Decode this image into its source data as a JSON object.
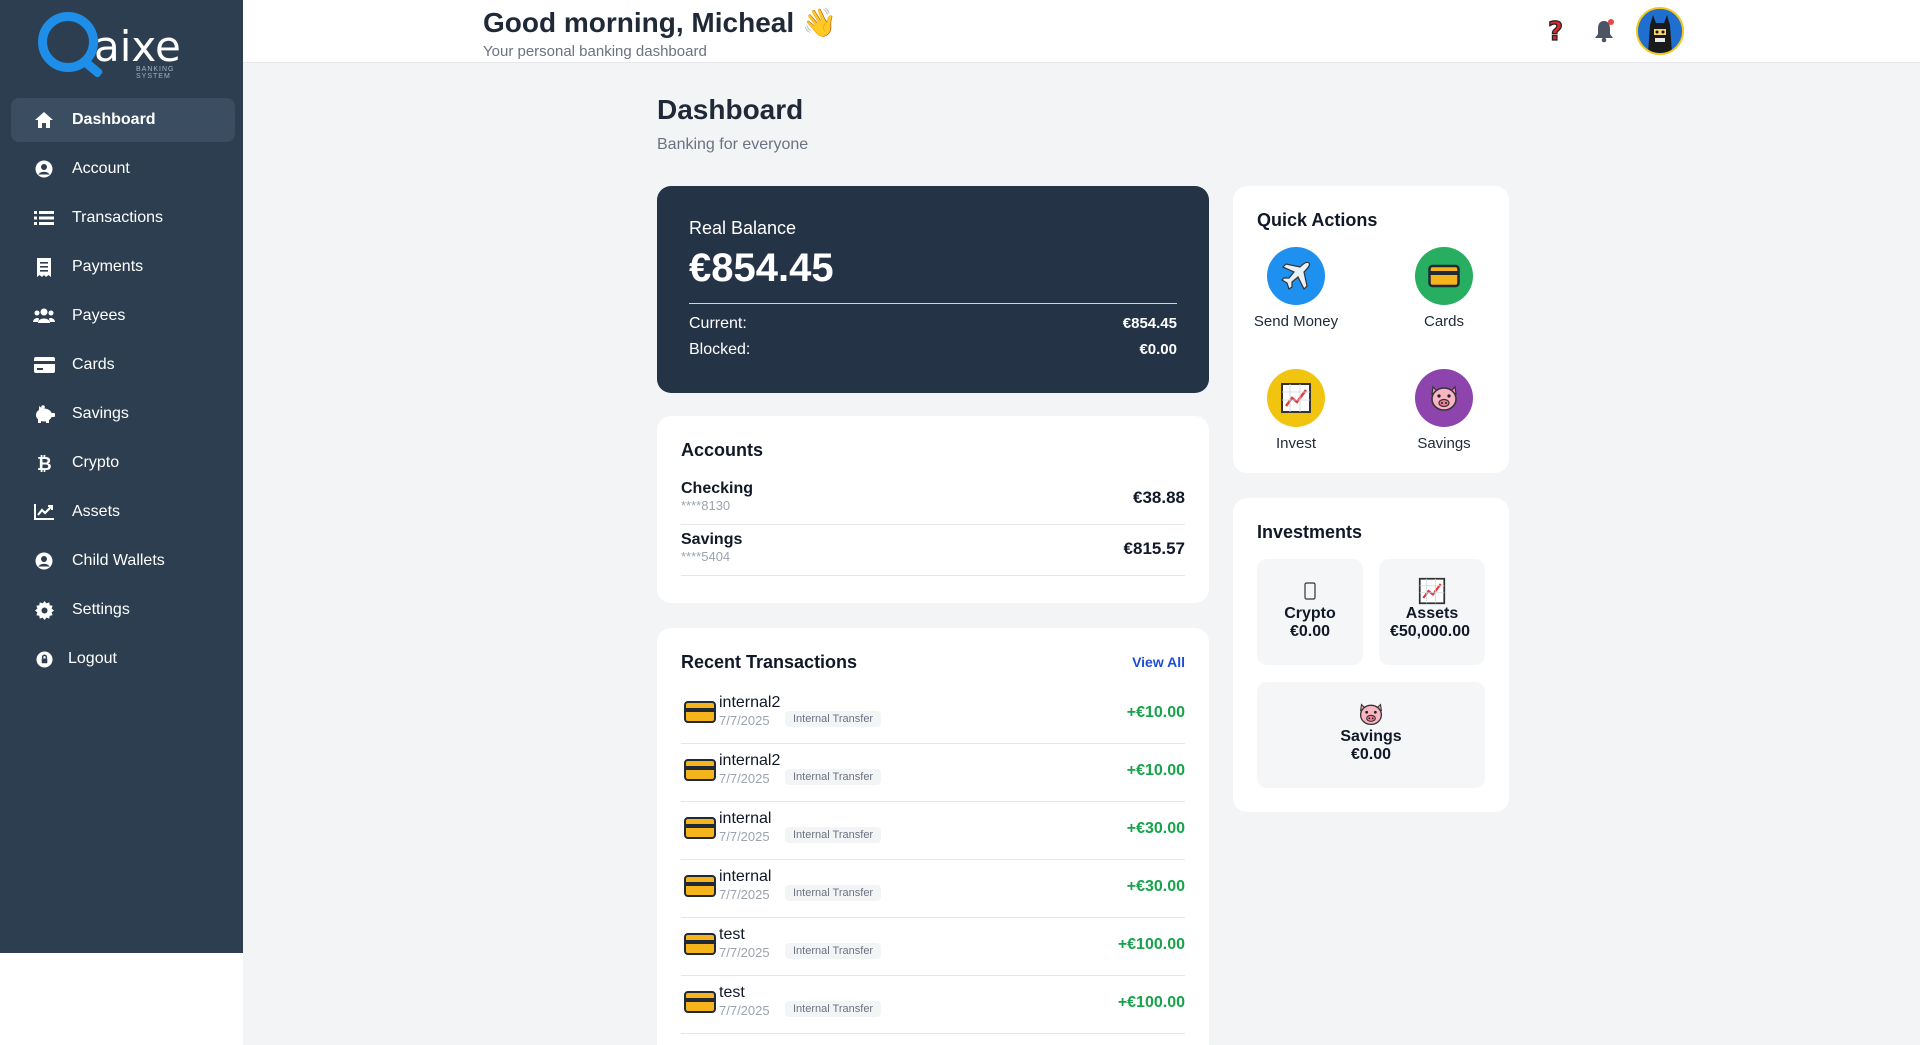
{
  "brand": {
    "name": "aixe",
    "tagline": "BANKING SYSTEM",
    "accent": "#1f8ee8"
  },
  "sidebar": {
    "items": [
      {
        "label": "Dashboard",
        "icon": "home-icon",
        "active": true
      },
      {
        "label": "Account",
        "icon": "user-circle-icon"
      },
      {
        "label": "Transactions",
        "icon": "list-icon"
      },
      {
        "label": "Payments",
        "icon": "receipt-icon"
      },
      {
        "label": "Payees",
        "icon": "users-icon"
      },
      {
        "label": "Cards",
        "icon": "credit-card-icon"
      },
      {
        "label": "Savings",
        "icon": "piggy-bank-icon"
      },
      {
        "label": "Crypto",
        "icon": "bitcoin-icon"
      },
      {
        "label": "Assets",
        "icon": "chart-line-icon"
      },
      {
        "label": "Child Wallets",
        "icon": "user-circle-icon"
      },
      {
        "label": "Settings",
        "icon": "gear-icon"
      },
      {
        "label": "Logout",
        "icon": "logout-icon"
      }
    ]
  },
  "header": {
    "greeting": "Good morning, Micheal",
    "greeting_emoji": "👋",
    "subtitle": "Your personal banking dashboard"
  },
  "page": {
    "title": "Dashboard",
    "subtitle": "Banking for everyone"
  },
  "balance": {
    "label": "Real Balance",
    "amount": "€854.45",
    "current_label": "Current:",
    "current_value": "€854.45",
    "blocked_label": "Blocked:",
    "blocked_value": "€0.00"
  },
  "accounts": {
    "title": "Accounts",
    "items": [
      {
        "name": "Checking",
        "number": "****8130",
        "balance": "€38.88"
      },
      {
        "name": "Savings",
        "number": "****5404",
        "balance": "€815.57"
      }
    ]
  },
  "recent": {
    "title": "Recent Transactions",
    "view_all": "View All",
    "items": [
      {
        "name": "internal2",
        "date": "7/7/2025",
        "type": "Internal Transfer",
        "amount": "+€10.00"
      },
      {
        "name": "internal2",
        "date": "7/7/2025",
        "type": "Internal Transfer",
        "amount": "+€10.00"
      },
      {
        "name": "internal",
        "date": "7/7/2025",
        "type": "Internal Transfer",
        "amount": "+€30.00"
      },
      {
        "name": "internal",
        "date": "7/7/2025",
        "type": "Internal Transfer",
        "amount": "+€30.00"
      },
      {
        "name": "test",
        "date": "7/7/2025",
        "type": "Internal Transfer",
        "amount": "+€100.00"
      },
      {
        "name": "test",
        "date": "7/7/2025",
        "type": "Internal Transfer",
        "amount": "+€100.00"
      }
    ]
  },
  "quick_actions": {
    "title": "Quick Actions",
    "items": [
      {
        "label": "Send Money",
        "icon": "airplane-icon",
        "color": "#1e90f0"
      },
      {
        "label": "Cards",
        "icon": "credit-card-icon",
        "color": "#27ae60"
      },
      {
        "label": "Invest",
        "icon": "chart-increasing-icon",
        "color": "#f1c40f"
      },
      {
        "label": "Savings",
        "icon": "pig-face-icon",
        "color": "#8e44ad"
      }
    ]
  },
  "investments": {
    "title": "Investments",
    "items": [
      {
        "name": "Crypto",
        "value": "€0.00",
        "icon": "mobile-phone-icon"
      },
      {
        "name": "Assets",
        "value": "€50,000.00",
        "icon": "chart-increasing-icon"
      },
      {
        "name": "Savings",
        "value": "€0.00",
        "icon": "pig-face-icon"
      }
    ]
  }
}
